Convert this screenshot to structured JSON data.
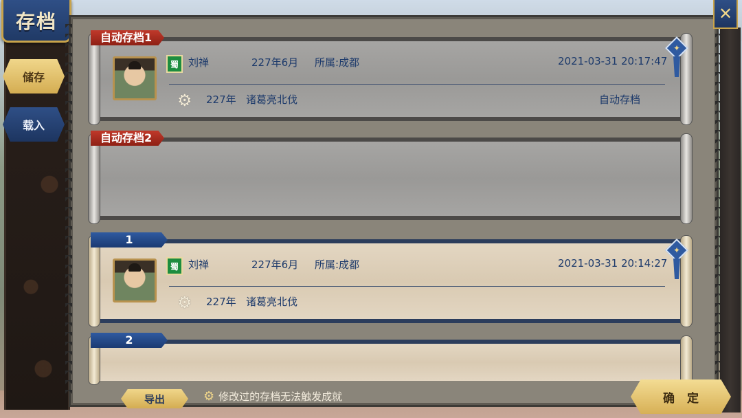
{
  "header": {
    "title": "存档",
    "close_icon": "close-icon"
  },
  "sidebar": {
    "tabs": [
      {
        "label": "储存"
      },
      {
        "label": "载入"
      }
    ]
  },
  "slots": [
    {
      "label": "自动存档1",
      "kind": "auto",
      "ruler": "刘禅",
      "faction": "蜀",
      "date": "227年6月",
      "location": "所属:成都",
      "timestamp": "2021-03-31   20:17:47",
      "year": "227年",
      "scenario": "诸葛亮北伐",
      "type_text": "自动存档"
    },
    {
      "label": "自动存档2",
      "kind": "auto"
    },
    {
      "label": "1",
      "kind": "manual",
      "ruler": "刘禅",
      "faction": "蜀",
      "date": "227年6月",
      "location": "所属:成都",
      "timestamp": "2021-03-31   20:14:27",
      "year": "227年",
      "scenario": "诸葛亮北伐"
    },
    {
      "label": "2",
      "kind": "manual"
    }
  ],
  "footer": {
    "export_label": "导出",
    "notice": "修改过的存档无法触发成就",
    "confirm_label": "确定"
  }
}
